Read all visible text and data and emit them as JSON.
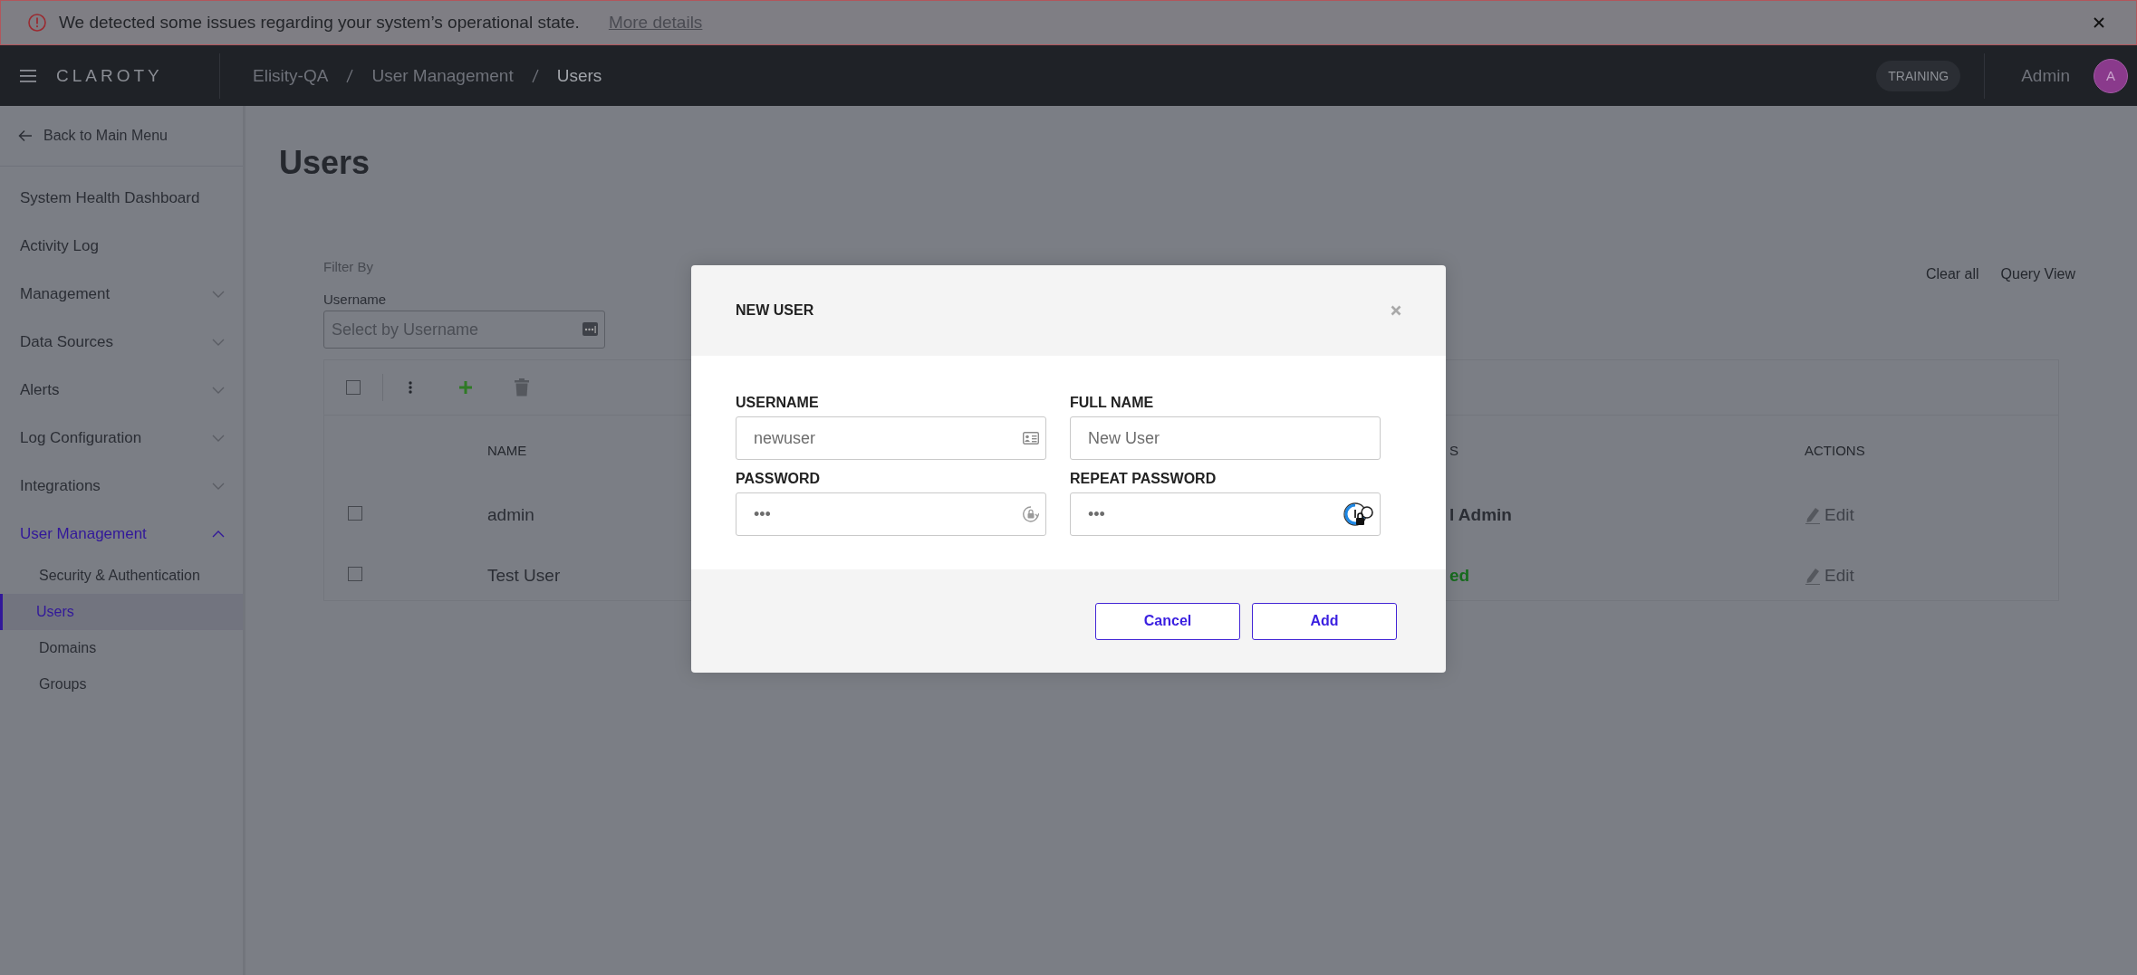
{
  "banner": {
    "message": "We detected some issues regarding your system’s operational state.",
    "link": "More details"
  },
  "header": {
    "logo": "CLAROTY",
    "breadcrumbs": [
      "Elisity-QA",
      "User Management",
      "Users"
    ],
    "badge": "TRAINING",
    "user": "Admin",
    "avatar": "A"
  },
  "sidebar": {
    "back": "Back to Main Menu",
    "items": [
      {
        "label": "System Health Dashboard",
        "kind": "link",
        "selected": false
      },
      {
        "label": "Activity Log",
        "kind": "link",
        "selected": false
      },
      {
        "label": "Management",
        "kind": "group",
        "expanded": false,
        "selected": false
      },
      {
        "label": "Data Sources",
        "kind": "group",
        "expanded": false,
        "selected": false
      },
      {
        "label": "Alerts",
        "kind": "group",
        "expanded": false,
        "selected": false
      },
      {
        "label": "Log Configuration",
        "kind": "group",
        "expanded": false,
        "selected": false
      },
      {
        "label": "Integrations",
        "kind": "group",
        "expanded": false,
        "selected": false
      },
      {
        "label": "User Management",
        "kind": "group",
        "expanded": true,
        "selected": true,
        "children": [
          {
            "label": "Security & Authentication",
            "selected": false
          },
          {
            "label": "Users",
            "selected": true
          },
          {
            "label": "Domains",
            "selected": false
          },
          {
            "label": "Groups",
            "selected": false
          }
        ]
      }
    ]
  },
  "page": {
    "title": "Users",
    "filter": {
      "heading": "Filter By",
      "label": "Username",
      "placeholder": "Select by Username"
    },
    "links": [
      "Clear all",
      "Query View"
    ],
    "table": {
      "select_all": {
        "checked": false
      },
      "columns": [
        "NAME",
        "S",
        "ACTIONS"
      ],
      "rows": [
        {
          "checked": false,
          "name": "admin",
          "column_2": "l Admin",
          "color": "#2b2e35",
          "action": "Edit"
        },
        {
          "checked": false,
          "name": "Test User",
          "column_2": "ed",
          "color": "#176b1e",
          "action": "Edit"
        }
      ]
    }
  },
  "dialog": {
    "title": "NEW USER",
    "fields": [
      {
        "label": "USERNAME",
        "value": "newuser",
        "kind": "id"
      },
      {
        "label": "FULL NAME",
        "value": "New User",
        "kind": "text"
      },
      {
        "label": "PASSWORD",
        "value": "•••",
        "kind": "password"
      },
      {
        "label": "REPEAT PASSWORD",
        "value": "•••",
        "kind": "manager"
      }
    ],
    "buttons": [
      "Cancel",
      "Add"
    ]
  }
}
